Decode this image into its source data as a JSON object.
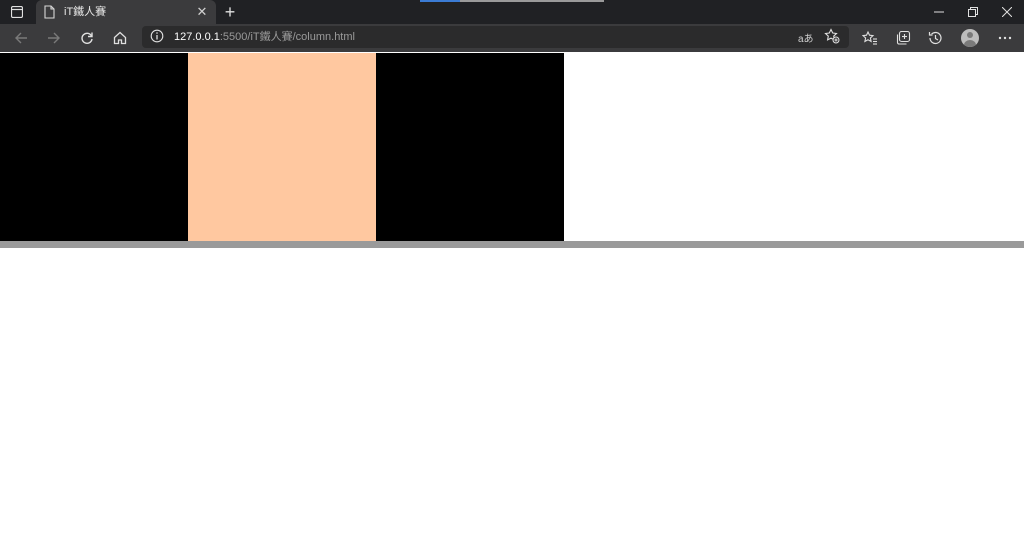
{
  "browser": {
    "tab": {
      "title": "iT鐵人賽",
      "close_glyph": "✕"
    },
    "new_tab_glyph": "+",
    "address": {
      "host": "127.0.0.1",
      "path": ":5500/iT鐵人賽/column.html"
    },
    "read_aloud_glyph": "aあ",
    "window_controls": {
      "minimize": "—",
      "restore": "❐",
      "close": "✕"
    }
  },
  "page": {
    "columns": [
      {
        "color": "#000000"
      },
      {
        "color": "#ffc8a0"
      },
      {
        "color": "#000000"
      }
    ],
    "border_color": "#9a9a9a",
    "background": "#ffffff"
  },
  "icons": {
    "tab-actions": "tab-actions-icon",
    "page": "page-icon",
    "back": "back-arrow-icon",
    "forward": "forward-arrow-icon",
    "refresh": "refresh-icon",
    "home": "home-icon",
    "info": "info-icon",
    "favorite_add": "star-plus-icon",
    "favorites": "favorites-icon",
    "collections": "collections-icon",
    "history": "history-icon",
    "profile": "avatar",
    "menu": "more-menu-icon"
  }
}
